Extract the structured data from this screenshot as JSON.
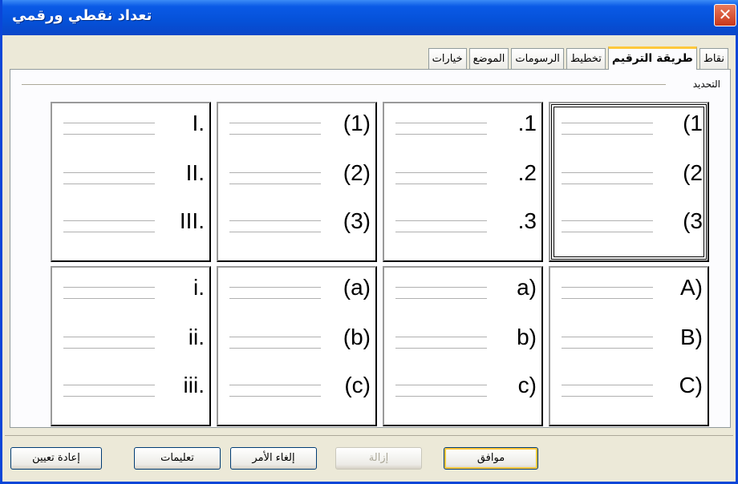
{
  "window": {
    "title": "تعداد نقطي ورقمي",
    "close_glyph": "✕"
  },
  "tabs": [
    {
      "label": "نقاط",
      "active": false
    },
    {
      "label": "طريقة الترقيم",
      "active": true
    },
    {
      "label": "تخطيط",
      "active": false
    },
    {
      "label": "الرسومات",
      "active": false
    },
    {
      "label": "الموضع",
      "active": false
    },
    {
      "label": "خيارات",
      "active": false
    }
  ],
  "selection_group": {
    "label": "التحديد"
  },
  "numbering_styles": [
    [
      "I.",
      "II.",
      "III."
    ],
    [
      "(1)",
      "(2)",
      "(3)"
    ],
    [
      ".1",
      ".2",
      ".3"
    ],
    [
      "(1",
      "(2",
      "(3"
    ],
    [
      "i.",
      "ii.",
      "iii."
    ],
    [
      "(a)",
      "(b)",
      "(c)"
    ],
    [
      "a)",
      "b)",
      "c)"
    ],
    [
      "A)",
      "B)",
      "C)"
    ]
  ],
  "selected_style_index": 3,
  "buttons": {
    "reset": "إعادة تعيين",
    "help": "تعليمات",
    "cancel": "إلغاء الأمر",
    "remove": "إزالة",
    "ok": "موافق"
  }
}
